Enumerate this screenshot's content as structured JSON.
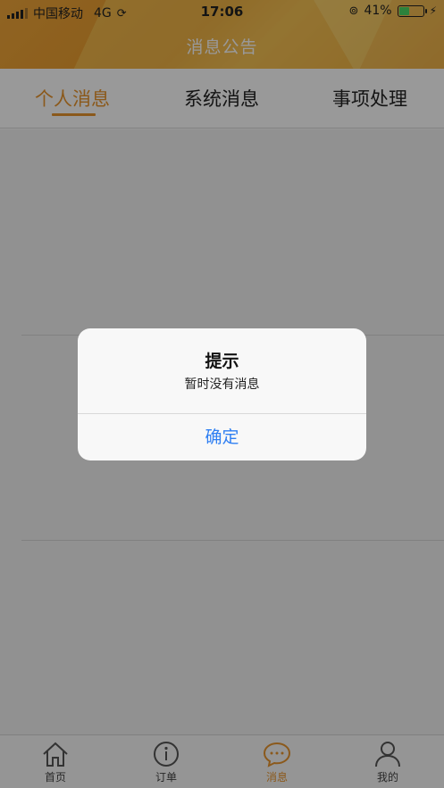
{
  "status_bar": {
    "carrier": "中国移动",
    "network": "4G",
    "time": "17:06",
    "battery_percent": "41%",
    "battery_level": 0.41
  },
  "header": {
    "title": "消息公告"
  },
  "tabs": [
    {
      "label": "个人消息",
      "active": true
    },
    {
      "label": "系统消息",
      "active": false
    },
    {
      "label": "事项处理",
      "active": false
    }
  ],
  "bottom_nav": [
    {
      "label": "首页",
      "icon": "home-icon",
      "active": false
    },
    {
      "label": "订单",
      "icon": "info-icon",
      "active": false
    },
    {
      "label": "消息",
      "icon": "chat-bubble-icon",
      "active": true
    },
    {
      "label": "我的",
      "icon": "person-icon",
      "active": false
    }
  ],
  "dialog": {
    "title": "提示",
    "message": "暂时没有消息",
    "confirm_label": "确定"
  },
  "colors": {
    "accent": "#e8942d",
    "link": "#2f7ff2"
  }
}
